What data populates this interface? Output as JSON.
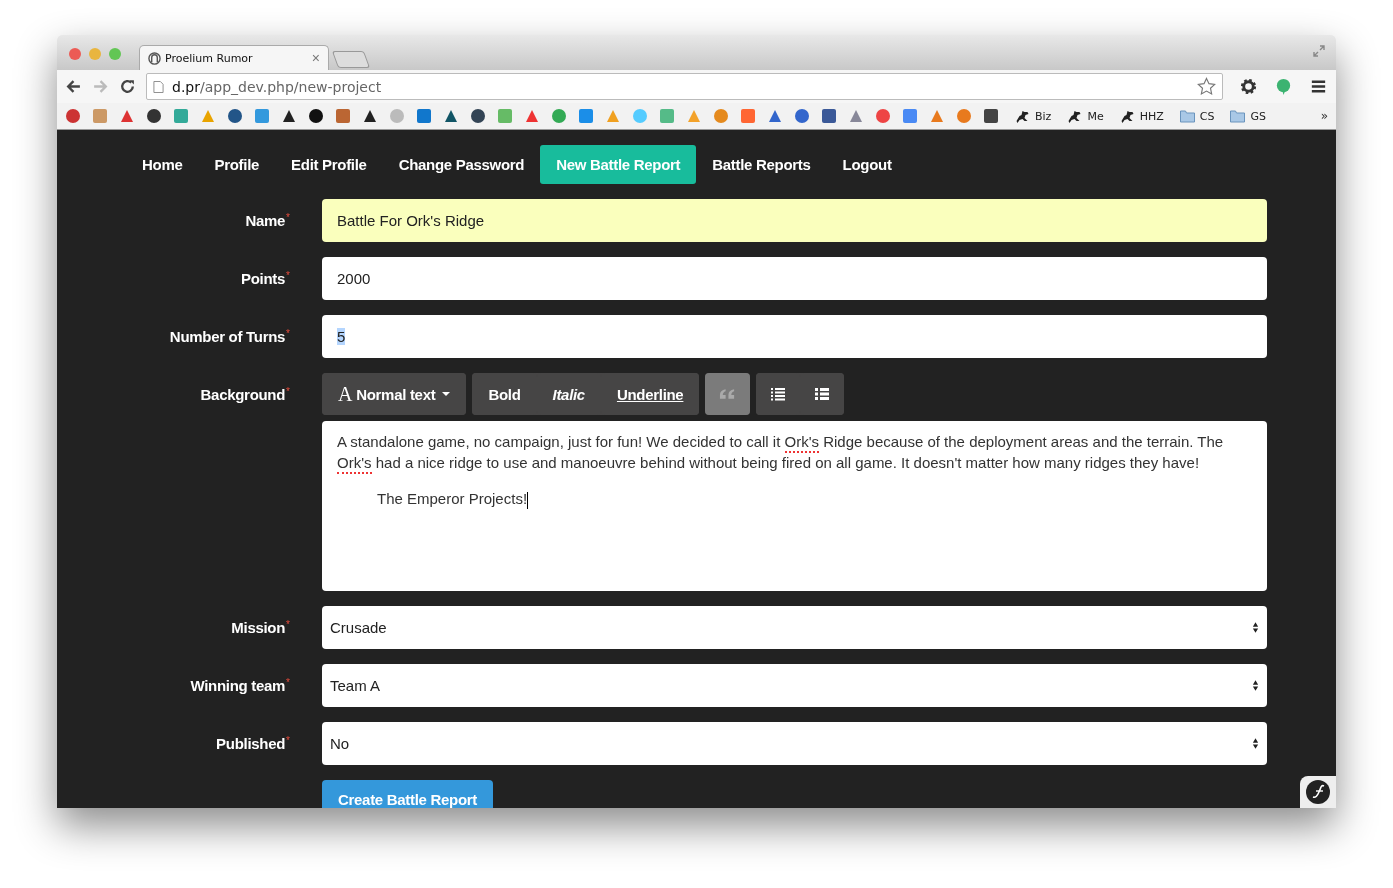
{
  "browser": {
    "tab_title": "Proelium Rumor",
    "tab_close": "×",
    "url_host": "d.pr",
    "url_path": "/app_dev.php/new-project",
    "bookmarks": [
      {
        "label": "Biz"
      },
      {
        "label": "Me"
      },
      {
        "label": "HHZ"
      },
      {
        "label": "CS",
        "kind": "folder"
      },
      {
        "label": "GS",
        "kind": "folder"
      }
    ],
    "more": "»"
  },
  "nav": [
    {
      "label": "Home",
      "selected": false
    },
    {
      "label": "Profile",
      "selected": false
    },
    {
      "label": "Edit Profile",
      "selected": false
    },
    {
      "label": "Change Password",
      "selected": false
    },
    {
      "label": "New Battle Report",
      "selected": true
    },
    {
      "label": "Battle Reports",
      "selected": false
    },
    {
      "label": "Logout",
      "selected": false
    }
  ],
  "fields": [
    {
      "kind": "input",
      "label": "Name",
      "required_mark": "*",
      "value": "Battle For Ork's Ridge",
      "autofilled": true,
      "text_selected": false
    },
    {
      "kind": "input",
      "label": "Points",
      "required_mark": "*",
      "value": "2000",
      "autofilled": false,
      "text_selected": false
    },
    {
      "kind": "input",
      "label": "Number of Turns",
      "required_mark": "*",
      "value": "5",
      "autofilled": false,
      "text_selected": true
    },
    {
      "kind": "editor",
      "label": "Background",
      "required_mark": "*",
      "toolbar": [
        {
          "items": [
            {
              "kind": "dropdown",
              "glyph": "A",
              "label": "Normal text",
              "active": false
            }
          ]
        },
        {
          "items": [
            {
              "kind": "bold",
              "label": "Bold",
              "active": false
            },
            {
              "kind": "italic",
              "label": "Italic",
              "active": false
            },
            {
              "kind": "underline",
              "label": "Underline",
              "active": false
            }
          ]
        },
        {
          "items": [
            {
              "kind": "quote",
              "active": true
            }
          ]
        },
        {
          "items": [
            {
              "kind": "bullets",
              "active": false
            },
            {
              "kind": "numbers",
              "active": false
            }
          ]
        }
      ],
      "paragraphs": [
        {
          "indented": false,
          "segments": [
            {
              "text": "A standalone game, no campaign, just for fun! We decided to call it ",
              "misspelled": false
            },
            {
              "text": "Ork's",
              "misspelled": true
            },
            {
              "text": " Ridge because of the deployment areas and the terrain. The ",
              "misspelled": false
            },
            {
              "text": "Ork's",
              "misspelled": true
            },
            {
              "text": " had a nice ridge to use and manoeuvre behind without being fired on all game. It doesn't matter how many ridges they have!",
              "misspelled": false
            }
          ]
        },
        {
          "indented": true,
          "caret": true,
          "segments": [
            {
              "text": "The Emperor Projects!",
              "misspelled": false
            }
          ]
        }
      ]
    },
    {
      "kind": "select",
      "label": "Mission",
      "required_mark": "*",
      "value": "Crusade"
    },
    {
      "kind": "select",
      "label": "Winning team",
      "required_mark": "*",
      "value": "Team A"
    },
    {
      "kind": "select",
      "label": "Published",
      "required_mark": "*",
      "value": "No"
    }
  ],
  "submit": "Create Battle Report"
}
